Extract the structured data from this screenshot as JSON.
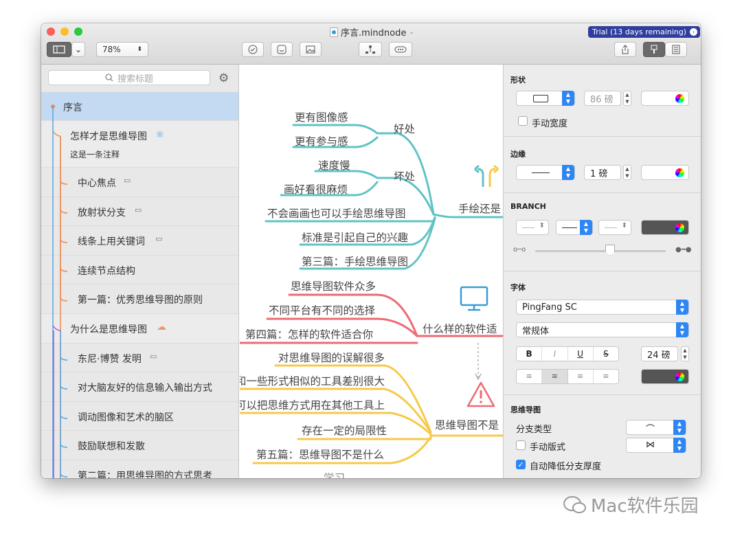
{
  "window": {
    "title": "序言.mindnode",
    "trial": "Trial (13 days remaining)",
    "zoom": "78%"
  },
  "sidebar": {
    "search_placeholder": "搜索标题",
    "items": [
      {
        "label": "序言"
      },
      {
        "label": "怎样才是思维导图",
        "note": "这是一条注释"
      },
      {
        "label": "中心焦点"
      },
      {
        "label": "放射状分支"
      },
      {
        "label": "线条上用关键词"
      },
      {
        "label": "连续节点结构"
      },
      {
        "label": "第一篇：优秀思维导图的原则"
      },
      {
        "label": "为什么是思维导图"
      },
      {
        "label": "东尼·博赞 发明"
      },
      {
        "label": "对大脑友好的信息输入输出方式"
      },
      {
        "label": "调动图像和艺术的脑区"
      },
      {
        "label": "鼓励联想和发散"
      },
      {
        "label": "第二篇：用思维导图的方式思考"
      }
    ]
  },
  "canvas": {
    "teal_leaves": [
      "更有图像感",
      "更有参与感",
      "速度慢",
      "画好看很麻烦",
      "不会画画也可以手绘思维导图",
      "标准是引起自己的兴趣",
      "第三篇：手绘思维导图"
    ],
    "teal_sub": [
      "好处",
      "坏处"
    ],
    "teal_main": "手绘还是",
    "red_leaves": [
      "思维导图软件众多",
      "不同平台有不同的选择",
      "第四篇：怎样的软件适合你"
    ],
    "red_main": "什么样的软件适",
    "yellow_leaves": [
      "对思维导图的误解很多",
      "和一些形式相似的工具差别很大",
      "可以把思维方式用在其他工具上",
      "存在一定的局限性",
      "第五篇：思维导图不是什么"
    ],
    "yellow_main": "思维导图不是",
    "bottom": "学习",
    "colors": {
      "teal": "#5fc3c4",
      "red": "#ee6a72",
      "yellow": "#f7c948"
    }
  },
  "inspector": {
    "shape": "形状",
    "shape_width": "86 磅",
    "manual_width": "手动宽度",
    "border": "边缘",
    "border_width": "1 磅",
    "branch": "BRANCH",
    "font": "字体",
    "font_family": "PingFang SC",
    "font_style": "常规体",
    "font_size": "24 磅",
    "fmt_bold": "B",
    "fmt_italic": "I",
    "fmt_underline": "U",
    "fmt_strike": "S",
    "mindmap": "思维导图",
    "branch_type": "分支类型",
    "manual_layout": "手动版式",
    "auto_thin": "自动降低分支厚度"
  },
  "watermark": "Mac软件乐园"
}
